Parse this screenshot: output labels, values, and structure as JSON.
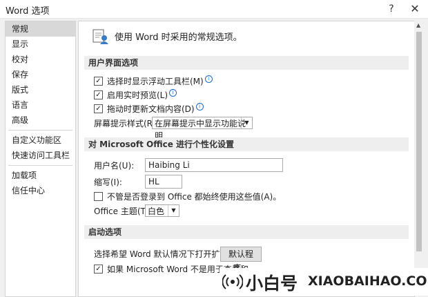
{
  "window": {
    "title": "Word 选项",
    "help": "?",
    "close": "✕"
  },
  "nav": [
    "常规",
    "显示",
    "校对",
    "保存",
    "版式",
    "语言",
    "高级",
    "自定义功能区",
    "快速访问工具栏",
    "加载项",
    "信任中心"
  ],
  "header": {
    "text": "使用 Word 时采用的常规选项。"
  },
  "ui_options": {
    "section": "用户界面选项",
    "cb1": "选择时显示浮动工具栏(M)",
    "cb2": "启用实时预览(L)",
    "cb3": "拖动时更新文档内容(D)",
    "tip_label": "屏幕提示样式(R):",
    "tip_value": "在屏幕提示中显示功能说明"
  },
  "personal": {
    "section": "对 Microsoft Office 进行个性化设置",
    "username_label": "用户名(U):",
    "username": "Haibing Li",
    "initials_label": "缩写(I):",
    "initials": "HL",
    "always_label": "不管是否登录到 Office 都始终使用这些值(A)。",
    "theme_label": "Office 主题(T):",
    "theme_value": "白色"
  },
  "startup": {
    "section": "启动选项",
    "ext_label": "选择希望 Word 默认情况下打开扩展名:",
    "default_button": "默认程序...",
    "cb_partial": "如果 Microsoft Word 不是用于查看和"
  },
  "watermark": {
    "cn": "小白号",
    "en": "XIAOBAIHAO.COM"
  }
}
